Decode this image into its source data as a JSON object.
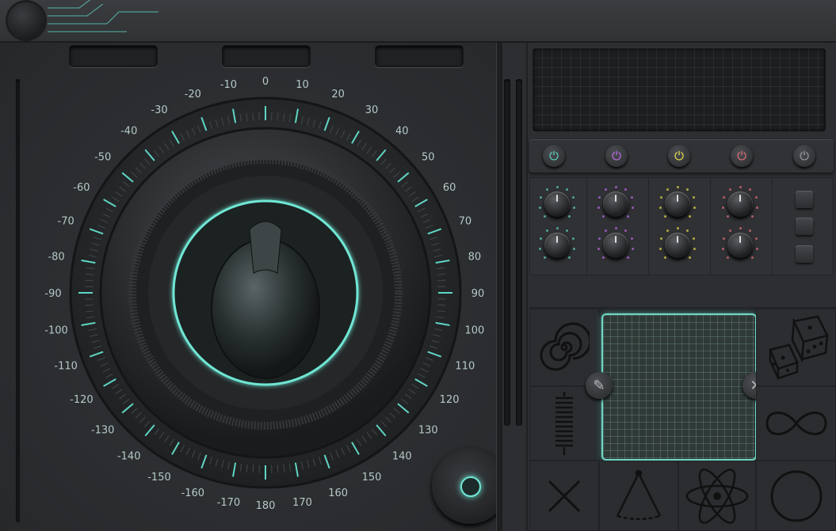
{
  "dial": {
    "scale_labels": [
      "0",
      "10",
      "20",
      "30",
      "40",
      "50",
      "60",
      "70",
      "80",
      "90",
      "100",
      "110",
      "120",
      "130",
      "140",
      "150",
      "160",
      "170",
      "180",
      "-170",
      "-160",
      "-150",
      "-140",
      "-130",
      "-120",
      "-110",
      "-100",
      "-90",
      "-80",
      "-70",
      "-60",
      "-50",
      "-40",
      "-30",
      "-20",
      "-10"
    ]
  },
  "colors": {
    "accent": "#5fd6c4",
    "power_teal": "#5fd6c4",
    "power_purple": "#c46bf0",
    "power_yellow": "#e8e04a",
    "power_red": "#e8707a",
    "power_gray": "#9a9da0"
  },
  "power_buttons": [
    {
      "icon": "power-icon",
      "color": "#5fd6c4"
    },
    {
      "icon": "power-icon",
      "color": "#c46bf0"
    },
    {
      "icon": "power-icon",
      "color": "#e8e04a"
    },
    {
      "icon": "power-icon",
      "color": "#e8707a"
    },
    {
      "icon": "power-icon",
      "color": "#9a9da0"
    }
  ],
  "pad_icons": [
    "spiral-icon",
    "dice-icon",
    "spring-icon",
    "infinity-icon",
    "cross-icon",
    "triangle-icon",
    "atom-icon",
    "circle-icon"
  ],
  "tools": {
    "edit_icon": "pencil-icon",
    "close_icon": "close-icon"
  }
}
